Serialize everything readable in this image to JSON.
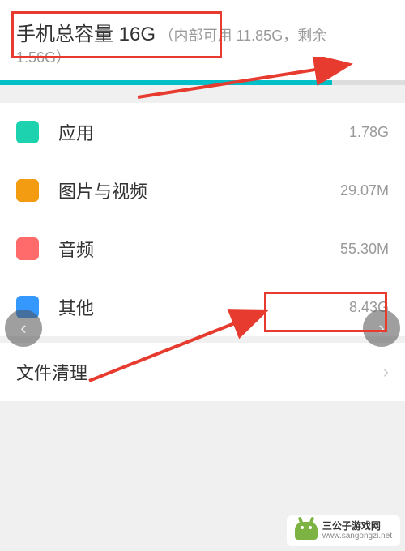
{
  "header": {
    "title": "手机总容量 16G",
    "subtext_prefix": "（内部可用 11.85G，剩余",
    "remaining": "1.56G）",
    "progress_percent": 82
  },
  "categories": [
    {
      "key": "apps",
      "label": "应用",
      "value": "1.78G",
      "color": "#1dd2af"
    },
    {
      "key": "media",
      "label": "图片与视频",
      "value": "29.07M",
      "color": "#f39c12"
    },
    {
      "key": "audio",
      "label": "音频",
      "value": "55.30M",
      "color": "#ff6b6b"
    },
    {
      "key": "other",
      "label": "其他",
      "value": "8.43G",
      "color": "#3498ff"
    }
  ],
  "cleanup": {
    "label": "文件清理"
  },
  "nav": {
    "prev": "‹",
    "next": "›"
  },
  "watermark": {
    "line1": "三公子游戏网",
    "line2": "www.sangongzi.net"
  },
  "annotation_color": "#e63b2e"
}
